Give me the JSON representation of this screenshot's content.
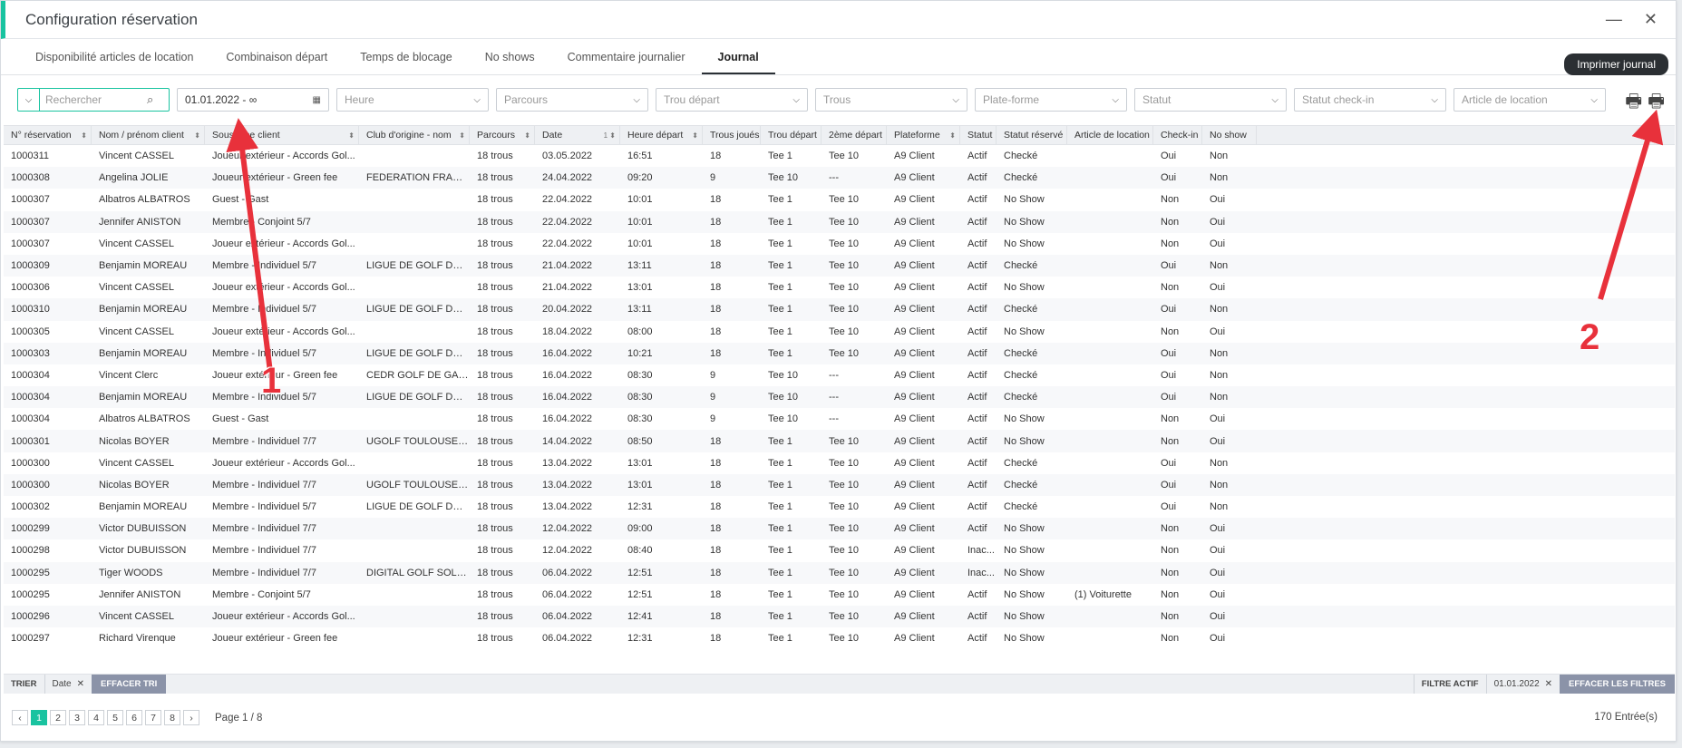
{
  "window": {
    "title": "Configuration réservation",
    "minimize_icon": "minimize-icon",
    "close_icon": "close-icon"
  },
  "tabs": [
    {
      "label": "Disponibilité articles de location",
      "active": false
    },
    {
      "label": "Combinaison départ",
      "active": false
    },
    {
      "label": "Temps de blocage",
      "active": false
    },
    {
      "label": "No shows",
      "active": false
    },
    {
      "label": "Commentaire journalier",
      "active": false
    },
    {
      "label": "Journal",
      "active": true
    }
  ],
  "filters": {
    "search_placeholder": "Rechercher",
    "date_value": "01.01.2022 - ∞",
    "heure": "Heure",
    "parcours": "Parcours",
    "trou_depart": "Trou départ",
    "trous": "Trous",
    "plateforme": "Plate-forme",
    "statut": "Statut",
    "statut_checkin": "Statut check-in",
    "article_location": "Article de location"
  },
  "tooltip": "Imprimer journal",
  "columns": [
    "N° réservation",
    "Nom / prénom client",
    "Sous-type client",
    "Club d'origine - nom",
    "Parcours",
    "Date",
    "Heure départ",
    "Trous joués",
    "Trou départ",
    "2ème départ",
    "Plateforme",
    "Statut",
    "Statut réservé",
    "Article de location",
    "Check-in",
    "No show"
  ],
  "rows": [
    [
      "1000311",
      "Vincent CASSEL",
      "Joueur extérieur - Accords Gol...",
      "",
      "18 trous",
      "03.05.2022",
      "16:51",
      "18",
      "Tee 1",
      "Tee 10",
      "A9 Client",
      "Actif",
      "Checké",
      "",
      "Oui",
      "Non"
    ],
    [
      "1000308",
      "Angelina JOLIE",
      "Joueur extérieur - Green fee",
      "FEDERATION FRANC...",
      "18 trous",
      "24.04.2022",
      "09:20",
      "9",
      "Tee 10",
      "---",
      "A9 Client",
      "Actif",
      "Checké",
      "",
      "Oui",
      "Non"
    ],
    [
      "1000307",
      "Albatros ALBATROS",
      "Guest - Gast",
      "",
      "18 trous",
      "22.04.2022",
      "10:01",
      "18",
      "Tee 1",
      "Tee 10",
      "A9 Client",
      "Actif",
      "No Show",
      "",
      "Non",
      "Oui"
    ],
    [
      "1000307",
      "Jennifer ANISTON",
      "Membre - Conjoint 5/7",
      "",
      "18 trous",
      "22.04.2022",
      "10:01",
      "18",
      "Tee 1",
      "Tee 10",
      "A9 Client",
      "Actif",
      "No Show",
      "",
      "Non",
      "Oui"
    ],
    [
      "1000307",
      "Vincent CASSEL",
      "Joueur extérieur - Accords Gol...",
      "",
      "18 trous",
      "22.04.2022",
      "10:01",
      "18",
      "Tee 1",
      "Tee 10",
      "A9 Client",
      "Actif",
      "No Show",
      "",
      "Non",
      "Oui"
    ],
    [
      "1000309",
      "Benjamin MOREAU",
      "Membre - Individuel 5/7",
      "LIGUE DE GOLF DU ...",
      "18 trous",
      "21.04.2022",
      "13:11",
      "18",
      "Tee 1",
      "Tee 10",
      "A9 Client",
      "Actif",
      "Checké",
      "",
      "Oui",
      "Non"
    ],
    [
      "1000306",
      "Vincent CASSEL",
      "Joueur extérieur - Accords Gol...",
      "",
      "18 trous",
      "21.04.2022",
      "13:01",
      "18",
      "Tee 1",
      "Tee 10",
      "A9 Client",
      "Actif",
      "No Show",
      "",
      "Non",
      "Oui"
    ],
    [
      "1000310",
      "Benjamin MOREAU",
      "Membre - Individuel 5/7",
      "LIGUE DE GOLF DU ...",
      "18 trous",
      "20.04.2022",
      "13:11",
      "18",
      "Tee 1",
      "Tee 10",
      "A9 Client",
      "Actif",
      "Checké",
      "",
      "Oui",
      "Non"
    ],
    [
      "1000305",
      "Vincent CASSEL",
      "Joueur extérieur - Accords Gol...",
      "",
      "18 trous",
      "18.04.2022",
      "08:00",
      "18",
      "Tee 1",
      "Tee 10",
      "A9 Client",
      "Actif",
      "No Show",
      "",
      "Non",
      "Oui"
    ],
    [
      "1000303",
      "Benjamin MOREAU",
      "Membre - Individuel 5/7",
      "LIGUE DE GOLF DU ...",
      "18 trous",
      "16.04.2022",
      "10:21",
      "18",
      "Tee 1",
      "Tee 10",
      "A9 Client",
      "Actif",
      "Checké",
      "",
      "Oui",
      "Non"
    ],
    [
      "1000304",
      "Vincent Clerc",
      "Joueur extérieur - Green fee",
      "CEDR GOLF DE GAR...",
      "18 trous",
      "16.04.2022",
      "08:30",
      "9",
      "Tee 10",
      "---",
      "A9 Client",
      "Actif",
      "Checké",
      "",
      "Oui",
      "Non"
    ],
    [
      "1000304",
      "Benjamin MOREAU",
      "Membre - Individuel 5/7",
      "LIGUE DE GOLF DU ...",
      "18 trous",
      "16.04.2022",
      "08:30",
      "9",
      "Tee 10",
      "---",
      "A9 Client",
      "Actif",
      "Checké",
      "",
      "Oui",
      "Non"
    ],
    [
      "1000304",
      "Albatros ALBATROS",
      "Guest - Gast",
      "",
      "18 trous",
      "16.04.2022",
      "08:30",
      "9",
      "Tee 10",
      "---",
      "A9 Client",
      "Actif",
      "No Show",
      "",
      "Non",
      "Oui"
    ],
    [
      "1000301",
      "Nicolas BOYER",
      "Membre - Individuel 7/7",
      "UGOLF TOULOUSE S...",
      "18 trous",
      "14.04.2022",
      "08:50",
      "18",
      "Tee 1",
      "Tee 10",
      "A9 Client",
      "Actif",
      "No Show",
      "",
      "Non",
      "Oui"
    ],
    [
      "1000300",
      "Vincent CASSEL",
      "Joueur extérieur - Accords Gol...",
      "",
      "18 trous",
      "13.04.2022",
      "13:01",
      "18",
      "Tee 1",
      "Tee 10",
      "A9 Client",
      "Actif",
      "Checké",
      "",
      "Oui",
      "Non"
    ],
    [
      "1000300",
      "Nicolas BOYER",
      "Membre - Individuel 7/7",
      "UGOLF TOULOUSE S...",
      "18 trous",
      "13.04.2022",
      "13:01",
      "18",
      "Tee 1",
      "Tee 10",
      "A9 Client",
      "Actif",
      "Checké",
      "",
      "Oui",
      "Non"
    ],
    [
      "1000302",
      "Benjamin MOREAU",
      "Membre - Individuel 5/7",
      "LIGUE DE GOLF DU ...",
      "18 trous",
      "13.04.2022",
      "12:31",
      "18",
      "Tee 1",
      "Tee 10",
      "A9 Client",
      "Actif",
      "Checké",
      "",
      "Oui",
      "Non"
    ],
    [
      "1000299",
      "Victor DUBUISSON",
      "Membre - Individuel 7/7",
      "",
      "18 trous",
      "12.04.2022",
      "09:00",
      "18",
      "Tee 1",
      "Tee 10",
      "A9 Client",
      "Actif",
      "No Show",
      "",
      "Non",
      "Oui"
    ],
    [
      "1000298",
      "Victor DUBUISSON",
      "Membre - Individuel 7/7",
      "",
      "18 trous",
      "12.04.2022",
      "08:40",
      "18",
      "Tee 1",
      "Tee 10",
      "A9 Client",
      "Inac...",
      "No Show",
      "",
      "Non",
      "Oui"
    ],
    [
      "1000295",
      "Tiger WOODS",
      "Membre - Individuel 7/7",
      "DIGITAL GOLF SOLU...",
      "18 trous",
      "06.04.2022",
      "12:51",
      "18",
      "Tee 1",
      "Tee 10",
      "A9 Client",
      "Inac...",
      "No Show",
      "",
      "Non",
      "Oui"
    ],
    [
      "1000295",
      "Jennifer ANISTON",
      "Membre - Conjoint 5/7",
      "",
      "18 trous",
      "06.04.2022",
      "12:51",
      "18",
      "Tee 1",
      "Tee 10",
      "A9 Client",
      "Actif",
      "No Show",
      "(1) Voiturette",
      "Non",
      "Oui"
    ],
    [
      "1000296",
      "Vincent CASSEL",
      "Joueur extérieur - Accords Gol...",
      "",
      "18 trous",
      "06.04.2022",
      "12:41",
      "18",
      "Tee 1",
      "Tee 10",
      "A9 Client",
      "Actif",
      "No Show",
      "",
      "Non",
      "Oui"
    ],
    [
      "1000297",
      "Richard Virenque",
      "Joueur extérieur - Green fee",
      "",
      "18 trous",
      "06.04.2022",
      "12:31",
      "18",
      "Tee 1",
      "Tee 10",
      "A9 Client",
      "Actif",
      "No Show",
      "",
      "Non",
      "Oui"
    ]
  ],
  "sort_bar": {
    "trier": "TRIER",
    "sort_field": "Date",
    "effacer_tri": "EFFACER TRI",
    "filtre_actif": "FILTRE ACTIF",
    "filter_value": "01.01.2022",
    "effacer_filtres": "EFFACER LES FILTRES"
  },
  "pager": {
    "pages": [
      "1",
      "2",
      "3",
      "4",
      "5",
      "6",
      "7",
      "8"
    ],
    "active_page": "1",
    "prev": "‹",
    "next": "›",
    "info": "Page 1 / 8"
  },
  "entries": "170 Entrée(s)",
  "annotations": {
    "one": "1",
    "two": "2"
  },
  "colors": {
    "accent": "#19c3a0",
    "arrow": "#e8313b",
    "button": "#8b93a8"
  }
}
